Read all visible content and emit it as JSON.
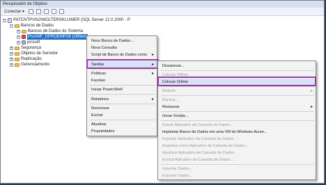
{
  "panel": {
    "title": "Pesquisador de Objetos"
  },
  "toolbar": {
    "connect_label": "Conectar ▾"
  },
  "tree": {
    "server": "PATCNTPVN2\\WOLTERSKLUWER (SQL Server 12.0.2000 - P",
    "databases": "Bancos de Dados",
    "system_dbs": "Bancos de Dados do Sistema",
    "selected_db": "ProANF_DPROEMP28 (Offline)",
    "prosoft": "prosoft",
    "security": "Segurança",
    "server_objects": "Objetos de Servidor",
    "replication": "Replicação",
    "management": "Gerenciamento"
  },
  "context_menu": {
    "items": [
      {
        "label": "Novo Banco de Dados..."
      },
      {
        "label": "Nova Consulta"
      },
      {
        "label": "Script de Banco de Dados como",
        "submenu": true
      },
      {
        "label": "Tarefas",
        "submenu": true,
        "highlighted": true
      },
      {
        "label": "Políticas",
        "submenu": true
      },
      {
        "label": "Facetas"
      },
      {
        "label": "Iniciar PowerShell"
      },
      {
        "label": "Relatórios",
        "submenu": true
      },
      {
        "label": "Renomear"
      },
      {
        "label": "Excluir"
      },
      {
        "label": "Atualizar"
      },
      {
        "label": "Propriedades"
      }
    ]
  },
  "submenu": {
    "items": [
      {
        "label": "Desanexar...",
        "disabled": false
      },
      {
        "label": "Colocar Offline",
        "disabled": true
      },
      {
        "label": "Colocar Online",
        "disabled": false,
        "highlighted": true
      },
      {
        "label": "Reduzir",
        "disabled": true,
        "submenu": true
      },
      {
        "label": "Backup...",
        "disabled": true
      },
      {
        "label": "Restaurar",
        "disabled": false,
        "submenu": true
      },
      {
        "label": "Gerar Scripts...",
        "disabled": false
      },
      {
        "label": "Extrair Aplicativo da Camada de Dados...",
        "disabled": true
      },
      {
        "label": "Implantar Banco de Dados em uma VM do Windows Azure...",
        "disabled": false
      },
      {
        "label": "Exportar Aplicativo da Camada de Dados...",
        "disabled": true
      },
      {
        "label": "Registrar como Aplicativo da Camada de Dados...",
        "disabled": true
      },
      {
        "label": "Atualizar Aplicativo da Camada de Dados...",
        "disabled": true
      },
      {
        "label": "Excluir Aplicativo da Camada de Dados...",
        "disabled": true
      },
      {
        "label": "Importar Dados...",
        "disabled": true
      },
      {
        "label": "Exportar Dados...",
        "disabled": true
      }
    ]
  },
  "colors": {
    "highlight_border": "#9b3aa6",
    "selection": "#1f6fc3"
  }
}
